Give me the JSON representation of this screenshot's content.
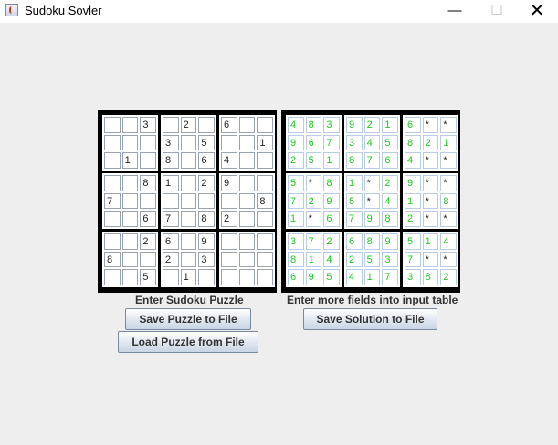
{
  "window": {
    "title": "Sudoku Sovler",
    "minimize_glyph": "—",
    "maximize_glyph": "☐",
    "close_glyph": "✕"
  },
  "input_board": [
    [
      [
        "",
        "",
        "3"
      ],
      [
        "",
        "",
        ""
      ],
      [
        "",
        "1",
        ""
      ]
    ],
    [
      [
        "",
        "2",
        ""
      ],
      [
        "3",
        "",
        "5"
      ],
      [
        "8",
        "",
        "6"
      ]
    ],
    [
      [
        "6",
        "",
        ""
      ],
      [
        "",
        "",
        "1"
      ],
      [
        "4",
        "",
        ""
      ]
    ],
    [
      [
        "",
        "",
        "8"
      ],
      [
        "7",
        "",
        ""
      ],
      [
        "",
        "",
        "6"
      ]
    ],
    [
      [
        "1",
        "",
        "2"
      ],
      [
        "",
        "",
        ""
      ],
      [
        "7",
        "",
        "8"
      ]
    ],
    [
      [
        "9",
        "",
        ""
      ],
      [
        "",
        "",
        "8"
      ],
      [
        "2",
        "",
        ""
      ]
    ],
    [
      [
        "",
        "",
        "2"
      ],
      [
        "8",
        "",
        ""
      ],
      [
        "",
        "",
        "5"
      ]
    ],
    [
      [
        "6",
        "",
        "9"
      ],
      [
        "2",
        "",
        "3"
      ],
      [
        "",
        "1",
        ""
      ]
    ],
    [
      [
        "",
        "",
        ""
      ],
      [
        "",
        "",
        ""
      ],
      [
        "",
        "",
        ""
      ]
    ]
  ],
  "solution_board": [
    [
      [
        "4",
        "8",
        "3"
      ],
      [
        "9",
        "6",
        "7"
      ],
      [
        "2",
        "5",
        "1"
      ]
    ],
    [
      [
        "9",
        "2",
        "1"
      ],
      [
        "3",
        "4",
        "5"
      ],
      [
        "8",
        "7",
        "6"
      ]
    ],
    [
      [
        "6",
        "*",
        "*"
      ],
      [
        "8",
        "2",
        "1"
      ],
      [
        "4",
        "*",
        "*"
      ]
    ],
    [
      [
        "5",
        "*",
        "8"
      ],
      [
        "7",
        "2",
        "9"
      ],
      [
        "1",
        "*",
        "6"
      ]
    ],
    [
      [
        "1",
        "*",
        "2"
      ],
      [
        "5",
        "*",
        "4"
      ],
      [
        "7",
        "9",
        "8"
      ]
    ],
    [
      [
        "9",
        "*",
        "*"
      ],
      [
        "1",
        "*",
        "8"
      ],
      [
        "2",
        "*",
        "*"
      ]
    ],
    [
      [
        "3",
        "7",
        "2"
      ],
      [
        "8",
        "1",
        "4"
      ],
      [
        "6",
        "9",
        "5"
      ]
    ],
    [
      [
        "6",
        "8",
        "9"
      ],
      [
        "2",
        "5",
        "3"
      ],
      [
        "4",
        "1",
        "7"
      ]
    ],
    [
      [
        "5",
        "1",
        "4"
      ],
      [
        "7",
        "*",
        "*"
      ],
      [
        "3",
        "8",
        "2"
      ]
    ]
  ],
  "labels": {
    "input": "Enter Sudoku Puzzle",
    "output": "Enter more fields into input table"
  },
  "buttons": {
    "save_puzzle": "Save Puzzle to File",
    "load_puzzle": "Load Puzzle from File",
    "save_solution": "Save Solution to File"
  },
  "colors": {
    "solution_digit": "#1ecb1e",
    "board_border": "#000000"
  }
}
